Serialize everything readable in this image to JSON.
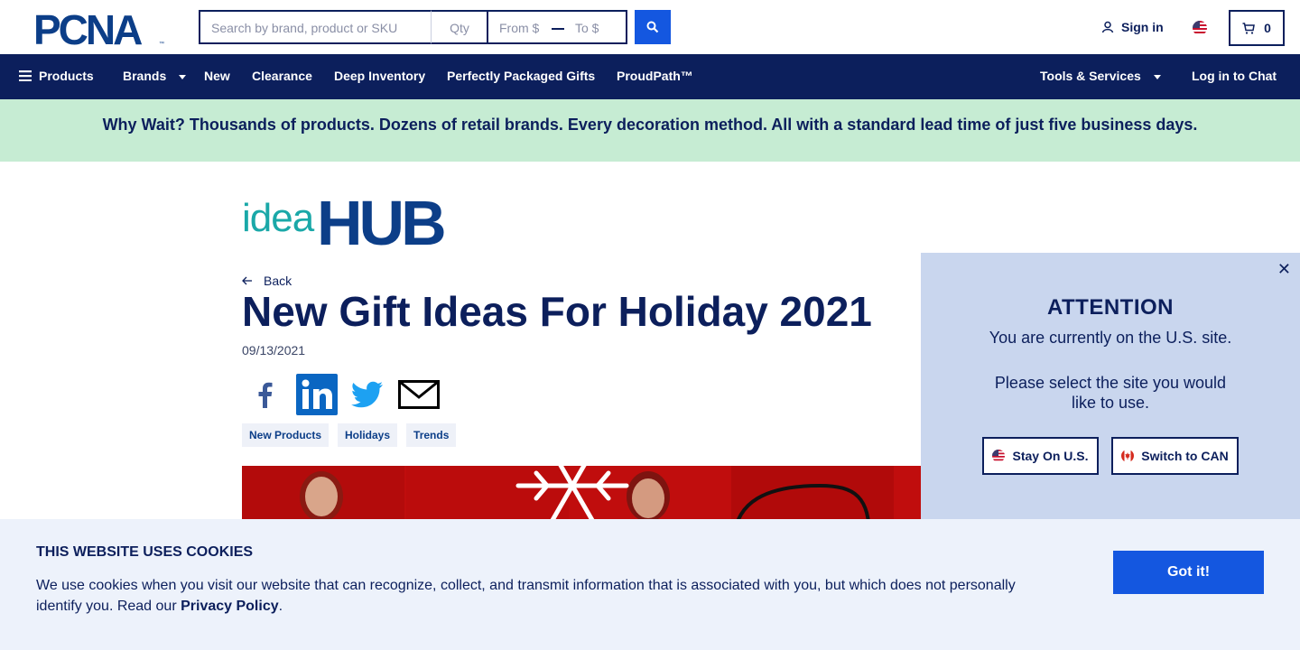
{
  "header": {
    "logo_text": "PCNA",
    "search_placeholder": "Search by brand, product or SKU",
    "qty_placeholder": "Qty",
    "price_from_placeholder": "From $",
    "price_to_placeholder": "To $",
    "signin_label": "Sign in",
    "cart_count": "0"
  },
  "nav": {
    "items": [
      {
        "label": "Products"
      },
      {
        "label": "Brands"
      },
      {
        "label": "New"
      },
      {
        "label": "Clearance"
      },
      {
        "label": "Deep Inventory"
      },
      {
        "label": "Perfectly Packaged Gifts"
      },
      {
        "label": "ProudPath™"
      }
    ],
    "tools_label": "Tools & Services",
    "chat_label": "Log in to Chat"
  },
  "promo": {
    "text": "Why Wait? Thousands of products. Dozens of retail brands. Every decoration method. All with a standard lead time of just five business days."
  },
  "article": {
    "brand_logo_idea": "idea",
    "brand_logo_hub": "HUB",
    "back_label": "Back",
    "title": "New Gift Ideas For Holiday 2021",
    "date": "09/13/2021",
    "share_icons": [
      "facebook-icon",
      "linkedin-icon",
      "twitter-icon",
      "email-icon"
    ],
    "tags": [
      "New Products",
      "Holidays",
      "Trends"
    ]
  },
  "attention": {
    "heading": "ATTENTION",
    "line1": "You are currently on the U.S. site.",
    "line2": "Please select the site you would like to use.",
    "stay_label": "Stay On U.S.",
    "switch_label": "Switch to CAN"
  },
  "cookie": {
    "heading": "THIS WEBSITE USES COOKIES",
    "body": "We use cookies when you visit our website that can recognize, collect, and transmit information that is associated with you, but which does not personally identify you. Read our ",
    "policy_link": "Privacy Policy",
    "body_end": ".",
    "button_label": "Got it!"
  },
  "colors": {
    "navy": "#0c1f5c",
    "accent_blue": "#1457e0",
    "promo_green": "#c6ecd3",
    "popup_blue": "#c9d6ee",
    "hero_red": "#c00d0d",
    "ideahub_teal": "#1aa8a8"
  }
}
